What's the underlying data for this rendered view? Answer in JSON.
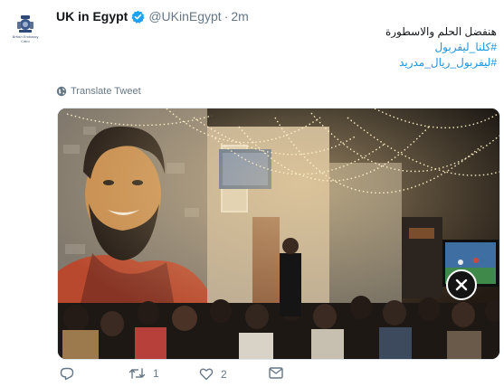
{
  "account": {
    "name": "UK in Egypt",
    "handle": "@UKinEgypt",
    "separator": "·",
    "time": "2m",
    "avatar_caption": [
      "British Embassy",
      "Cairo"
    ]
  },
  "tweet": {
    "line1": "هنفضل الحلم والاسطورة",
    "hashtag1": "#كلنا_ليفربول",
    "hashtag2": "#ليفربول_ريال_مدريد"
  },
  "translate_label": "Translate Tweet",
  "actions": {
    "retweet_count": "1",
    "like_count": "2"
  },
  "icons": {
    "verified": "verified-badge-icon",
    "globe": "globe-icon",
    "reply": "reply-icon",
    "retweet": "retweet-icon",
    "like": "heart-icon",
    "message": "envelope-icon",
    "close": "close-icon"
  },
  "colors": {
    "link": "#1b95e0",
    "secondary_text": "#657786",
    "verified": "#1da1f2"
  }
}
